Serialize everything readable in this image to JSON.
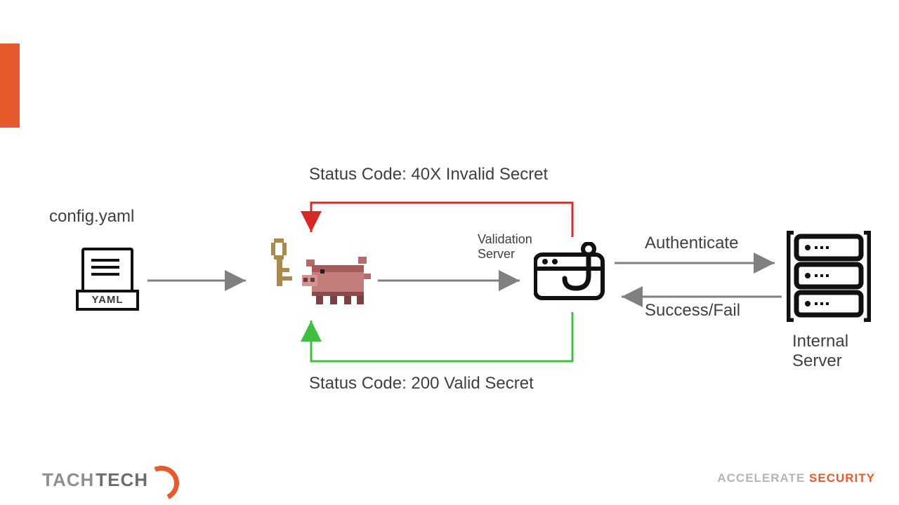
{
  "accent_color": "#e65a2e",
  "diagram": {
    "config_label": "config.yaml",
    "yaml_badge": "YAML",
    "status_40x": "Status Code: 40X Invalid Secret",
    "status_200": "Status Code: 200 Valid Secret",
    "validation_server_label": "Validation\nServer",
    "authenticate_label": "Authenticate",
    "successfail_label": "Success/Fail",
    "internal_server_label": "Internal\nServer"
  },
  "branding": {
    "logo_light": "TACH",
    "logo_bold": "TECH",
    "tagline_a": "ACCELERATE",
    "tagline_b": "SECURITY"
  },
  "colors": {
    "arrow_gray": "#808080",
    "arrow_red": "#d42a2a",
    "arrow_green": "#3fbf3f"
  }
}
